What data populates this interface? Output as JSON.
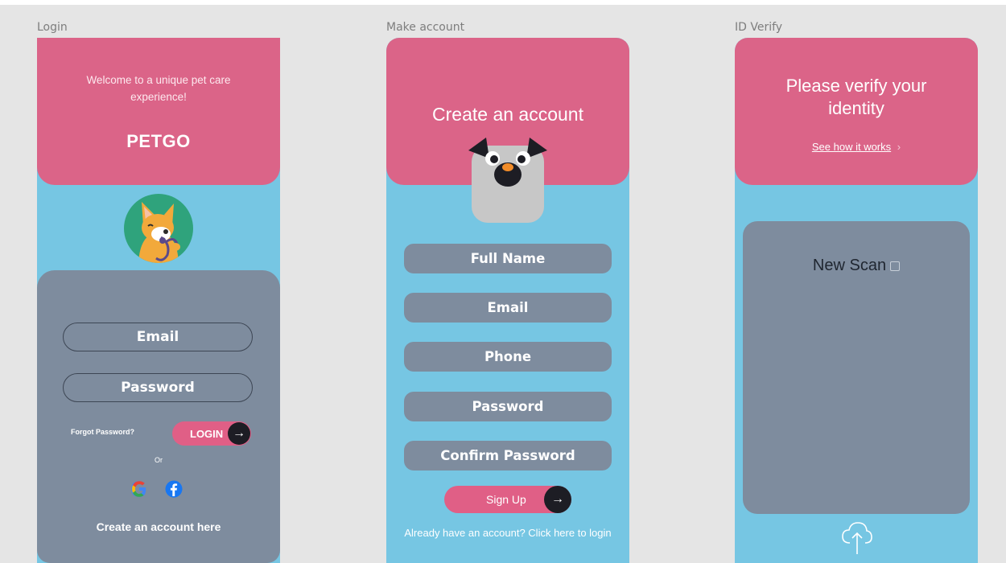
{
  "frames": {
    "login": "Login",
    "make_account": "Make account",
    "id_verify": "ID Verify"
  },
  "login": {
    "welcome": "Welcome to a unique pet care experience!",
    "brand": "PETGO",
    "email": "Email",
    "password": "Password",
    "forgot": "Forgot Password?",
    "login_button": "LOGIN",
    "or": "Or",
    "create_link": "Create an account here"
  },
  "signup": {
    "title": "Create an account",
    "fields": [
      "Full Name",
      "Email",
      "Phone",
      "Password",
      "Confirm Password"
    ],
    "button": "Sign Up",
    "already": "Already have an account? Click here to login"
  },
  "verify": {
    "title": "Please verify your identity",
    "see_how": "See how it works",
    "new_scan": "New Scan"
  },
  "icons": {
    "arrow": "arrow-right-icon",
    "google": "google-icon",
    "facebook": "facebook-icon",
    "chevron": "chevron-right-icon",
    "scan": "scan-icon",
    "upload": "cloud-upload-icon"
  },
  "colors": {
    "pink": "#db6488",
    "sky": "#76c6e3",
    "slate": "#7e8c9e",
    "button": "#e05f86",
    "canvas": "#e5e5e5"
  }
}
